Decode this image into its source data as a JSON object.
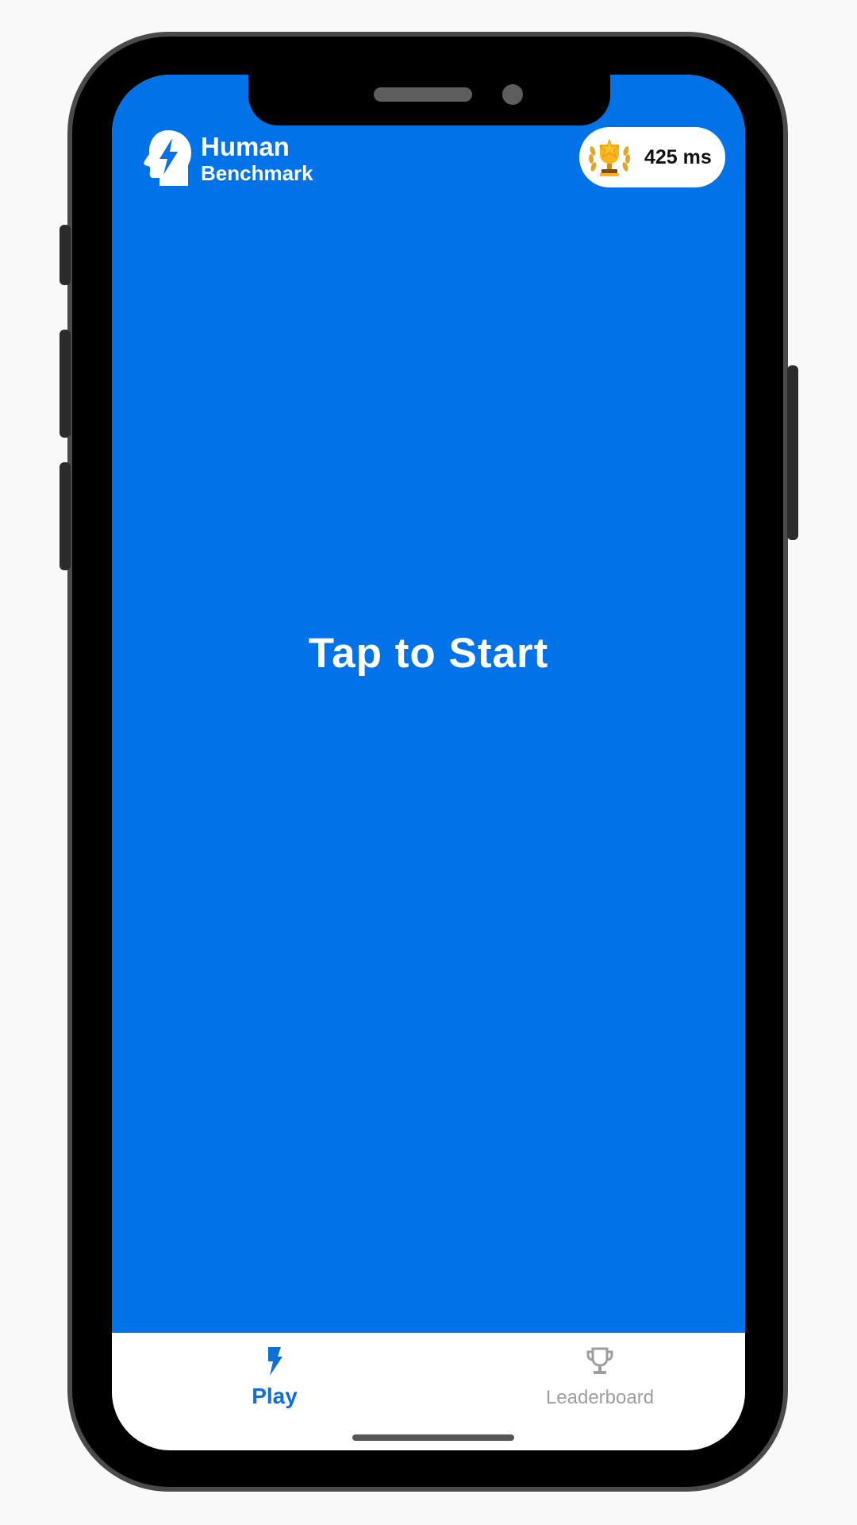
{
  "app": {
    "logo_line1": "Human",
    "logo_line2": "Benchmark",
    "best_score": "425 ms",
    "icons": {
      "logo": "head-lightning-icon",
      "best": "trophy-laurel-icon"
    }
  },
  "game": {
    "prompt": "Tap to Start",
    "background_color": "#0172e7"
  },
  "tabs": [
    {
      "label": "Play",
      "icon": "lightning-icon",
      "active": true,
      "color": "#0f6fd8"
    },
    {
      "label": "Leaderboard",
      "icon": "trophy-icon",
      "active": false,
      "color": "#9e9e9e"
    }
  ]
}
